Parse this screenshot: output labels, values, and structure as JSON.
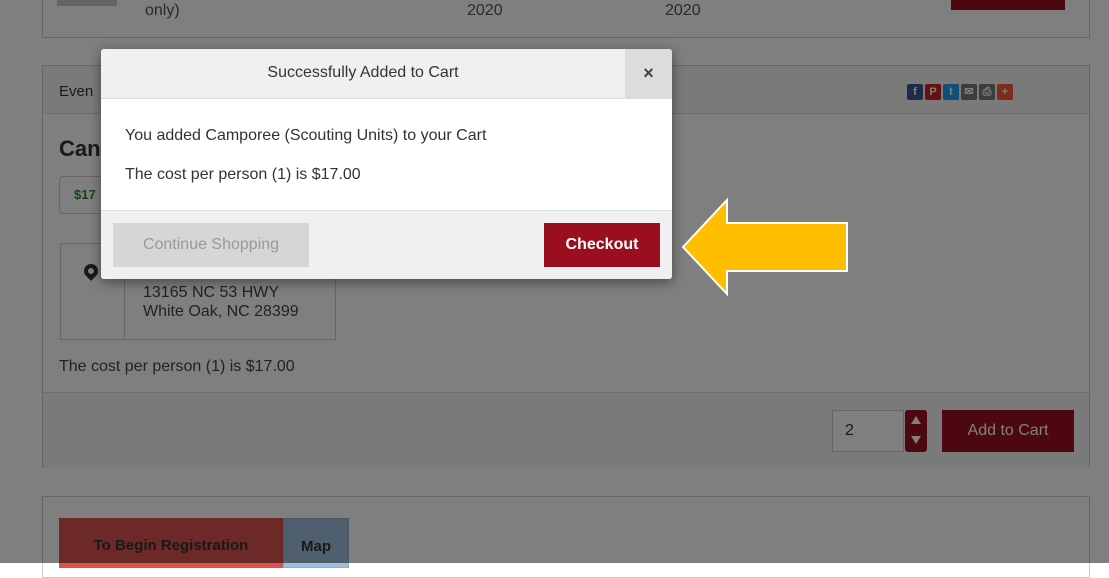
{
  "top_card": {
    "col1": "only)",
    "col2": "2020",
    "col3": "2020"
  },
  "event_card": {
    "header_label": "Even",
    "title": "Can",
    "price": "$17",
    "address_line1": "13165 NC 53 HWY",
    "address_line2": "White Oak, NC 28399",
    "cost_line": "The cost per person (1) is $17.00",
    "quantity": "2",
    "add_to_cart": "Add to Cart",
    "share_icons": [
      "facebook-icon",
      "pinterest-icon",
      "twitter-icon",
      "email-icon",
      "print-icon",
      "plus-icon"
    ]
  },
  "bottom_card": {
    "tab_register": "To Begin Registration",
    "tab_map": "Map"
  },
  "modal": {
    "title": "Successfully Added to Cart",
    "close": "×",
    "message1": "You added Camporee (Scouting Units) to your Cart",
    "message2": "The cost per person (1) is $17.00",
    "continue_label": "Continue Shopping",
    "checkout_label": "Checkout"
  },
  "colors": {
    "brand_red": "#9a0f1f",
    "arrow_yellow": "#ffbf00",
    "price_green": "#2a8a2a"
  }
}
